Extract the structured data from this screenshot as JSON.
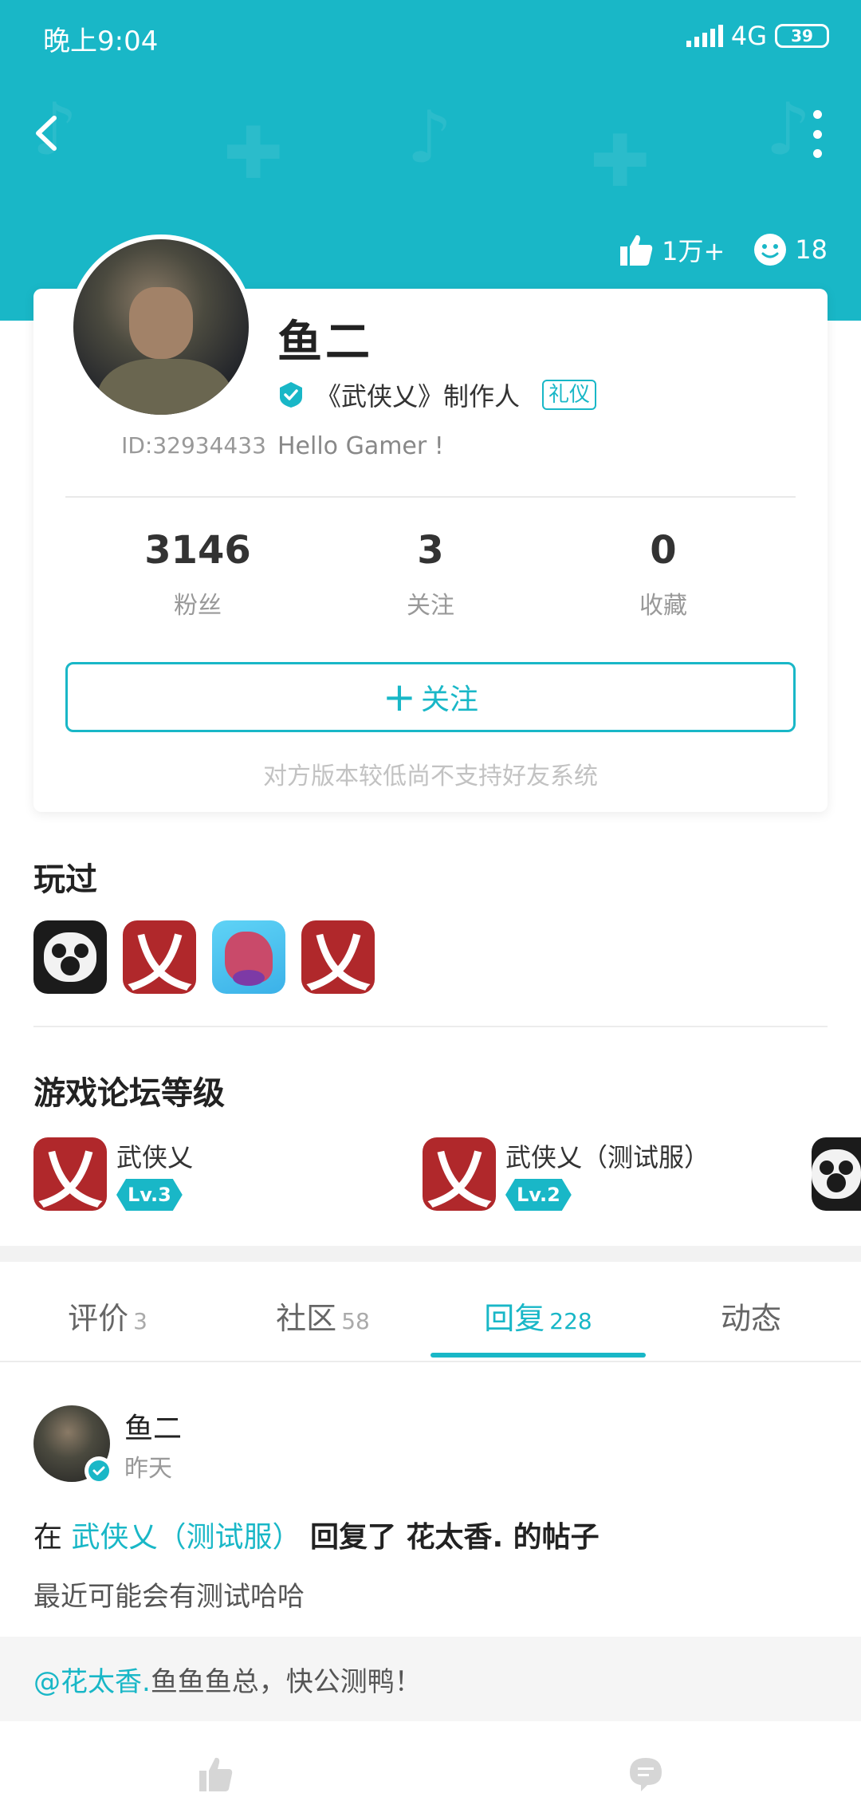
{
  "status_bar": {
    "time": "晚上9:04",
    "network": "4G",
    "battery": "39"
  },
  "header": {
    "likes": "1万+",
    "smiles": "18",
    "accent_color": "#19b7c7"
  },
  "profile": {
    "name": "鱼二",
    "verified_title": "《武侠乂》制作人",
    "tag": "礼仪",
    "bio": "Hello Gamer !",
    "user_id": "ID:32934433",
    "stats": [
      {
        "value": "3146",
        "label": "粉丝"
      },
      {
        "value": "3",
        "label": "关注"
      },
      {
        "value": "0",
        "label": "收藏"
      }
    ],
    "follow_button": "关注",
    "note": "对方版本较低尚不支持好友系统"
  },
  "played": {
    "title": "玩过",
    "games": [
      "panda-game-icon",
      "wuxia-game-icon",
      "dino-game-icon",
      "wuxia-game-icon"
    ]
  },
  "forum_levels": {
    "title": "游戏论坛等级",
    "items": [
      {
        "name": "武侠乂",
        "level": "Lv.3"
      },
      {
        "name": "武侠乂（测试服）",
        "level": "Lv.2"
      }
    ]
  },
  "tabs": [
    {
      "label": "评价",
      "count": "3"
    },
    {
      "label": "社区",
      "count": "58"
    },
    {
      "label": "回复",
      "count": "228"
    },
    {
      "label": "动态",
      "count": ""
    }
  ],
  "post": {
    "author": "鱼二",
    "time": "昨天",
    "prefix": "在",
    "forum": "武侠乂（测试服）",
    "action": "回复了 花太香. 的帖子",
    "body": "最近可能会有测试哈哈",
    "quote_mention": "@花太香.",
    "quote_text": " 鱼鱼鱼总，快公测鸭！"
  }
}
